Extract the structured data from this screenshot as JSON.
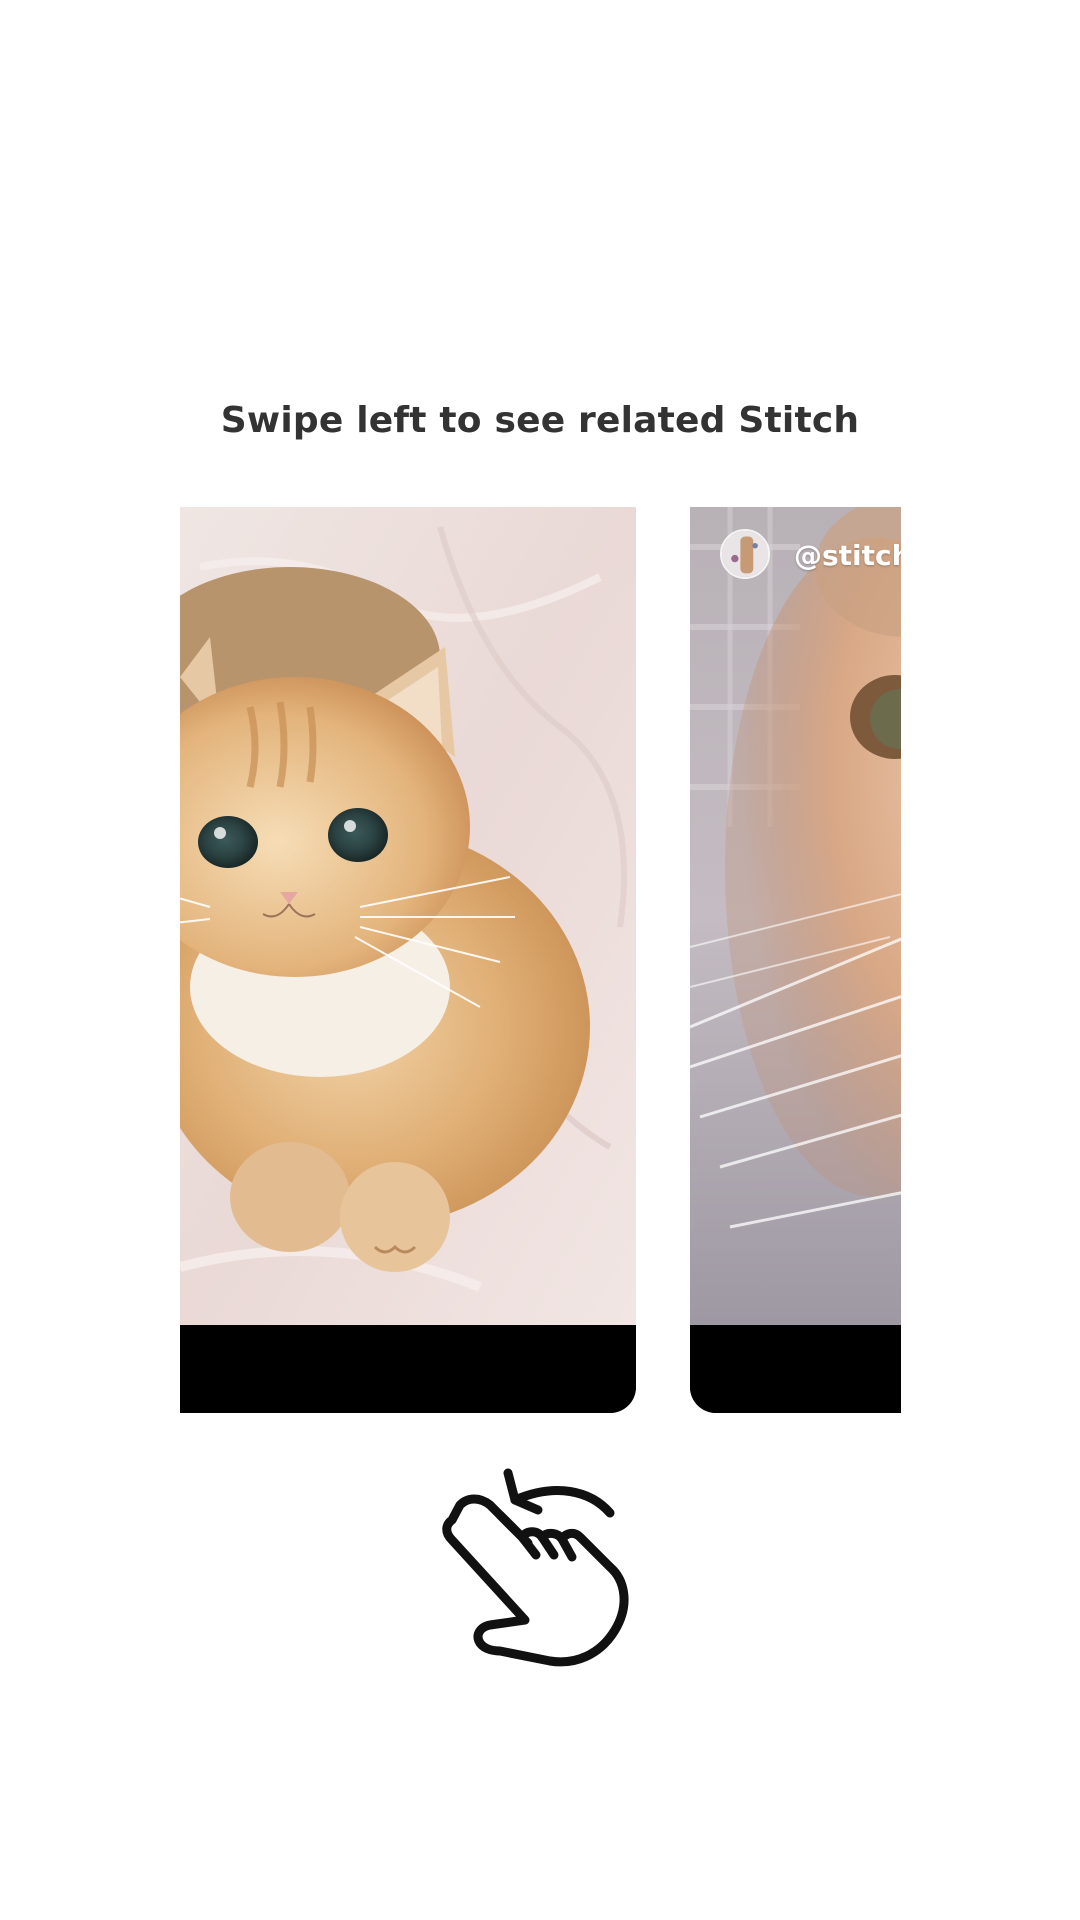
{
  "prompt": {
    "title": "Swipe left to see related Stitch"
  },
  "cards": [
    {
      "image": "cat-photo-golden-kitten-on-white-sheet",
      "footer_color": "#000000"
    },
    {
      "image": "cat-photo-closeup-face-whiskers",
      "avatar": "avatar-icon",
      "handle": "@stitch",
      "footer_color": "#000000"
    }
  ],
  "gesture": {
    "icon": "swipe-left-hand-icon"
  },
  "colors": {
    "background": "#ffffff",
    "title_text": "#333333",
    "card_footer": "#000000"
  }
}
